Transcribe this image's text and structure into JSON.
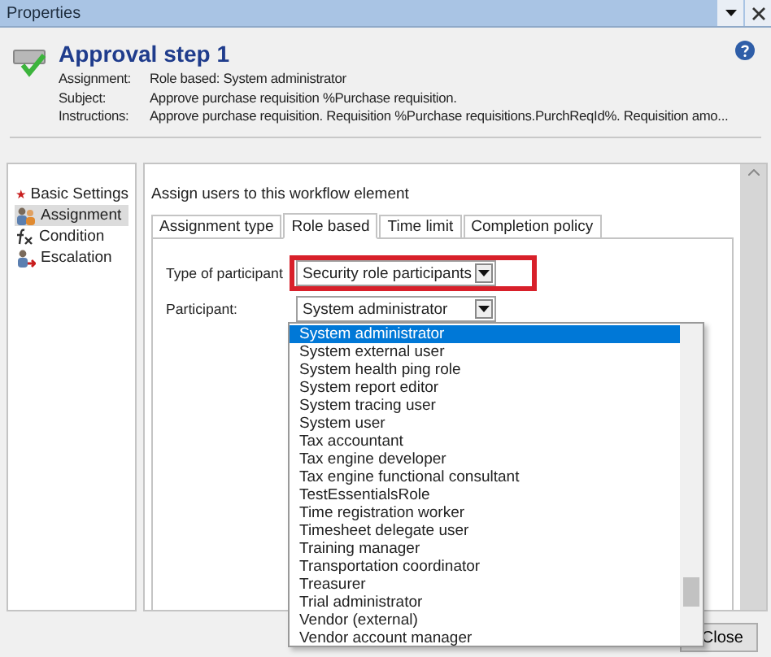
{
  "window": {
    "title": "Properties"
  },
  "header": {
    "title": "Approval step 1",
    "details": [
      {
        "label": "Assignment:",
        "value": "Role based: System administrator"
      },
      {
        "label": "Subject:",
        "value": "Approve purchase requisition %Purchase requisition."
      },
      {
        "label": "Instructions:",
        "value": "Approve purchase requisition. Requisition %Purchase requisitions.PurchReqId%. Requisition amo..."
      }
    ]
  },
  "nav": [
    {
      "label": "Basic Settings",
      "kind": "star",
      "selected": false
    },
    {
      "label": "Assignment",
      "kind": "users",
      "selected": true
    },
    {
      "label": "Condition",
      "kind": "fx",
      "selected": false
    },
    {
      "label": "Escalation",
      "kind": "escalate",
      "selected": false
    }
  ],
  "panel": {
    "heading": "Assign users to this workflow element",
    "tabs": [
      {
        "label": "Assignment type",
        "selected": false
      },
      {
        "label": "Role based",
        "selected": true
      },
      {
        "label": "Time limit",
        "selected": false
      },
      {
        "label": "Completion policy",
        "selected": false
      }
    ],
    "fields": [
      {
        "label": "Type of participant",
        "value": "Security role participants",
        "highlighted": true
      },
      {
        "label": "Participant:",
        "value": "System administrator",
        "highlighted": false
      }
    ],
    "dropdown": {
      "items": [
        {
          "label": "System administrator",
          "selected": true
        },
        {
          "label": "System external user",
          "selected": false
        },
        {
          "label": "System health ping role",
          "selected": false
        },
        {
          "label": "System report editor",
          "selected": false
        },
        {
          "label": "System tracing user",
          "selected": false
        },
        {
          "label": "System user",
          "selected": false
        },
        {
          "label": "Tax accountant",
          "selected": false
        },
        {
          "label": "Tax engine developer",
          "selected": false
        },
        {
          "label": "Tax engine functional consultant",
          "selected": false
        },
        {
          "label": "TestEssentialsRole",
          "selected": false
        },
        {
          "label": "Time registration worker",
          "selected": false
        },
        {
          "label": "Timesheet delegate user",
          "selected": false
        },
        {
          "label": "Training manager",
          "selected": false
        },
        {
          "label": "Transportation coordinator",
          "selected": false
        },
        {
          "label": "Treasurer",
          "selected": false
        },
        {
          "label": "Trial administrator",
          "selected": false
        },
        {
          "label": "Vendor (external)",
          "selected": false
        },
        {
          "label": "Vendor account manager",
          "selected": false
        }
      ]
    }
  },
  "buttons": [
    "Close"
  ]
}
